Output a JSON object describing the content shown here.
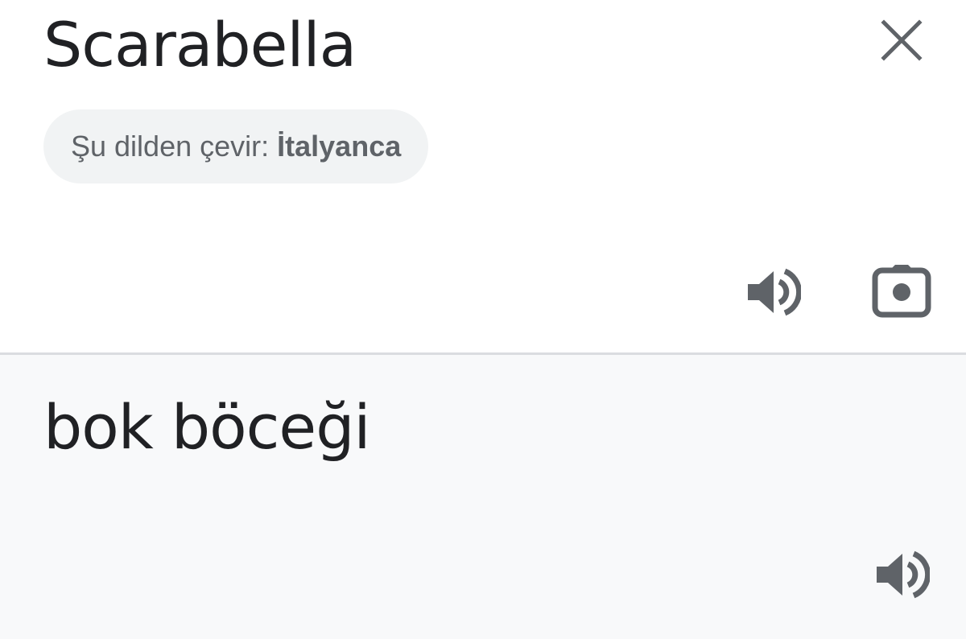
{
  "source": {
    "text": "Scarabella",
    "language_prefix": "Şu dilden çevir:",
    "language_name": "İtalyanca"
  },
  "target": {
    "text": "bok böceği"
  },
  "icons": {
    "close": "close-icon",
    "speaker": "volume-up-icon",
    "camera": "camera-icon"
  },
  "colors": {
    "text_primary": "#202124",
    "icon_gray": "#5f6368",
    "chip_bg": "#f1f3f4",
    "target_bg": "#f8f9fa",
    "divider": "#dadce0"
  }
}
